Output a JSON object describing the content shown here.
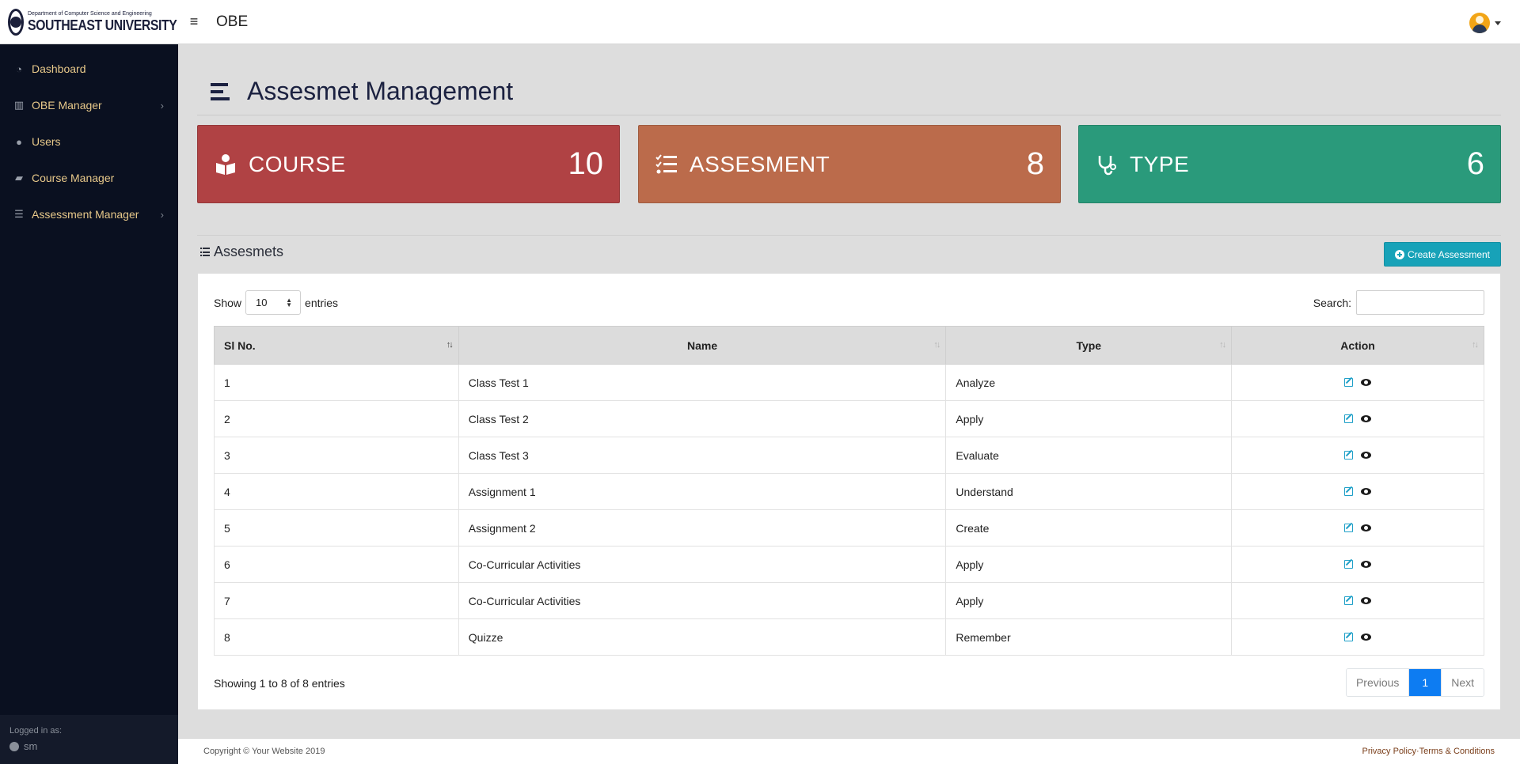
{
  "header": {
    "logo_subtitle": "Department of Computer Science and Engineering",
    "logo_title": "SOUTHEAST UNIVERSITY",
    "brand": "OBE"
  },
  "sidebar": {
    "items": [
      {
        "label": "Dashboard",
        "icon": "dashboard-icon"
      },
      {
        "label": "OBE Manager",
        "icon": "columns-icon"
      },
      {
        "label": "Users",
        "icon": "users-icon"
      },
      {
        "label": "Course Manager",
        "icon": "course-icon"
      },
      {
        "label": "Assessment Manager",
        "icon": "bars-icon"
      }
    ],
    "footer_label": "Logged in as:",
    "footer_user": "sm"
  },
  "page": {
    "title": "Assesmet Management"
  },
  "cards": {
    "course": {
      "label": "COURSE",
      "value": "10",
      "color": "#b04244"
    },
    "assessment": {
      "label": "ASSESMENT",
      "value": "8",
      "color": "#bb6b4b"
    },
    "type": {
      "label": "TYPE",
      "value": "6",
      "color": "#2a9a7b"
    }
  },
  "section": {
    "title": "Assesmets",
    "create_label": "Create Assessment"
  },
  "table": {
    "show_label": "Show",
    "page_size": "10",
    "entries_label": "entries",
    "search_label": "Search:",
    "columns": [
      "Sl No.",
      "Name",
      "Type",
      "Action"
    ],
    "rows": [
      {
        "sl": "1",
        "name": "Class Test 1",
        "type": "Analyze"
      },
      {
        "sl": "2",
        "name": "Class Test 2",
        "type": "Apply"
      },
      {
        "sl": "3",
        "name": "Class Test 3",
        "type": "Evaluate"
      },
      {
        "sl": "4",
        "name": "Assignment 1",
        "type": "Understand"
      },
      {
        "sl": "5",
        "name": "Assignment 2",
        "type": "Create"
      },
      {
        "sl": "6",
        "name": "Co-Curricular Activities",
        "type": "Apply"
      },
      {
        "sl": "7",
        "name": "Co-Curricular Activities",
        "type": "Apply"
      },
      {
        "sl": "8",
        "name": "Quizze",
        "type": "Remember"
      }
    ],
    "info": "Showing 1 to 8 of 8 entries",
    "pagination": {
      "previous": "Previous",
      "current": "1",
      "next": "Next"
    }
  },
  "footer": {
    "copyright": "Copyright © Your Website 2019",
    "privacy": "Privacy Policy",
    "separator": " · ",
    "terms": "Terms & Conditions"
  }
}
